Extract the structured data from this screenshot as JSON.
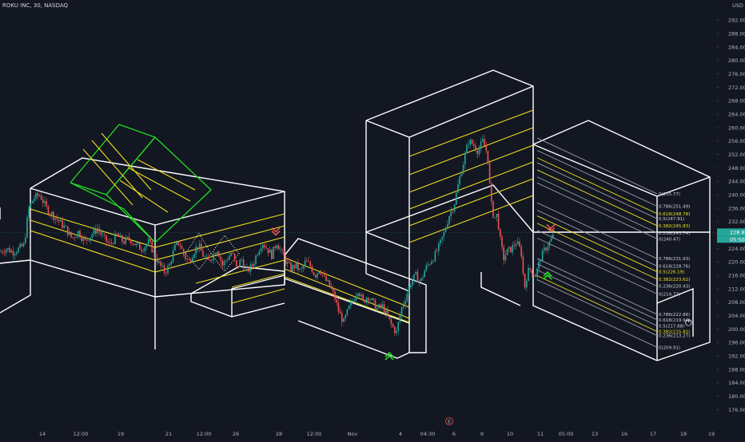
{
  "header": {
    "ticker": "ROKU INC, 30, NASDAQ",
    "currency": "USD"
  },
  "price_tags": [
    {
      "value": "228.81",
      "color": "#26a69a"
    },
    {
      "value": "05:50",
      "color": "#26a69a"
    }
  ],
  "colors": {
    "background": "#131722",
    "up": "#26a69a",
    "down": "#ef5350",
    "box_lines": "#ffffff",
    "green_box": "#22dd22",
    "yellow_lines": "#f0e020",
    "fib_lines": "#9a9aa8"
  },
  "chart_data": {
    "type": "candlestick",
    "title": "ROKU INC, 30, NASDAQ",
    "y_axis": {
      "unit": "USD",
      "range": [
        174,
        296
      ],
      "ticks": [
        "292.00",
        "288.00",
        "284.00",
        "280.00",
        "276.00",
        "272.00",
        "268.00",
        "264.00",
        "260.00",
        "256.00",
        "252.00",
        "248.00",
        "244.00",
        "240.00",
        "236.00",
        "232.00",
        "228.00",
        "224.00",
        "220.00",
        "216.00",
        "212.00",
        "208.00",
        "204.00",
        "200.00",
        "196.00",
        "192.00",
        "188.00",
        "184.00",
        "180.00",
        "176.00"
      ]
    },
    "x_axis": {
      "tick_labels": [
        "14",
        "12:00",
        "19",
        "21",
        "12:00",
        "26",
        "28",
        "12:00",
        "Nov",
        "4",
        "04:30",
        "6",
        "9",
        "10",
        "11",
        "05:00",
        "13",
        "16",
        "17",
        "18",
        "19"
      ]
    },
    "price_path": [
      [
        0,
        223
      ],
      [
        8,
        224
      ],
      [
        16,
        223
      ],
      [
        24,
        224
      ],
      [
        30,
        225
      ],
      [
        36,
        236
      ],
      [
        42,
        239
      ],
      [
        50,
        240
      ],
      [
        58,
        236
      ],
      [
        66,
        234
      ],
      [
        74,
        232
      ],
      [
        82,
        230
      ],
      [
        90,
        227
      ],
      [
        98,
        229
      ],
      [
        106,
        226
      ],
      [
        114,
        228
      ],
      [
        122,
        230
      ],
      [
        130,
        227
      ],
      [
        138,
        225
      ],
      [
        146,
        228
      ],
      [
        154,
        226
      ],
      [
        162,
        227
      ],
      [
        170,
        225
      ],
      [
        178,
        224
      ],
      [
        186,
        226
      ],
      [
        194,
        222
      ],
      [
        200,
        219
      ],
      [
        206,
        217
      ],
      [
        212,
        219
      ],
      [
        218,
        224
      ],
      [
        224,
        226
      ],
      [
        230,
        222
      ],
      [
        236,
        220
      ],
      [
        242,
        223
      ],
      [
        248,
        225
      ],
      [
        254,
        222
      ],
      [
        260,
        220
      ],
      [
        266,
        222
      ],
      [
        272,
        224
      ],
      [
        278,
        219
      ],
      [
        284,
        221
      ],
      [
        290,
        223
      ],
      [
        296,
        218
      ],
      [
        302,
        221
      ],
      [
        308,
        217
      ],
      [
        316,
        219
      ],
      [
        322,
        223
      ],
      [
        328,
        226
      ],
      [
        334,
        224
      ],
      [
        340,
        222
      ],
      [
        346,
        226
      ],
      [
        352,
        223
      ],
      [
        358,
        220
      ],
      [
        364,
        218
      ],
      [
        370,
        219
      ],
      [
        376,
        217
      ],
      [
        382,
        220
      ],
      [
        388,
        219
      ],
      [
        394,
        216
      ],
      [
        400,
        218
      ],
      [
        406,
        215
      ],
      [
        412,
        213
      ],
      [
        418,
        210
      ],
      [
        424,
        205
      ],
      [
        430,
        202
      ],
      [
        436,
        206
      ],
      [
        442,
        209
      ],
      [
        448,
        212
      ],
      [
        454,
        208
      ],
      [
        460,
        210
      ],
      [
        466,
        208
      ],
      [
        472,
        206
      ],
      [
        478,
        207
      ],
      [
        484,
        204
      ],
      [
        490,
        201
      ],
      [
        496,
        199
      ],
      [
        502,
        206
      ],
      [
        508,
        210
      ],
      [
        514,
        214
      ],
      [
        520,
        216
      ],
      [
        526,
        214
      ],
      [
        532,
        218
      ],
      [
        538,
        220
      ],
      [
        544,
        222
      ],
      [
        550,
        225
      ],
      [
        556,
        229
      ],
      [
        562,
        234
      ],
      [
        568,
        237
      ],
      [
        574,
        244
      ],
      [
        580,
        250
      ],
      [
        586,
        256
      ],
      [
        592,
        255
      ],
      [
        598,
        253
      ],
      [
        604,
        256
      ],
      [
        610,
        252
      ],
      [
        614,
        238
      ],
      [
        618,
        233
      ],
      [
        622,
        234
      ],
      [
        626,
        226
      ],
      [
        630,
        221
      ],
      [
        634,
        223
      ],
      [
        640,
        224
      ],
      [
        646,
        226
      ],
      [
        652,
        223
      ],
      [
        656,
        212
      ],
      [
        660,
        217
      ],
      [
        664,
        218
      ],
      [
        670,
        216
      ],
      [
        676,
        221
      ],
      [
        682,
        224
      ],
      [
        688,
        226
      ],
      [
        693,
        228
      ]
    ],
    "fib_levels": [
      {
        "label": "0(255.77)",
        "price": 240.3,
        "highlight": false
      },
      {
        "label": "0.786(251.49)",
        "price": 236.6,
        "highlight": false
      },
      {
        "label": "0.618(248.78)",
        "price": 234.4,
        "highlight": true
      },
      {
        "label": "0.5(247.91)",
        "price": 232.9,
        "highlight": false
      },
      {
        "label": "0.382(245.83)",
        "price": 230.8,
        "highlight": true
      },
      {
        "label": "0.236(243.74)",
        "price": 228.7,
        "highlight": false
      },
      {
        "label": "0(240.47)",
        "price": 226.9,
        "highlight": false
      },
      {
        "label": "0.786(231.93)",
        "price": 221.0,
        "highlight": false
      },
      {
        "label": "0.618(228.76)",
        "price": 218.8,
        "highlight": false
      },
      {
        "label": "0.5(226.19)",
        "price": 217.1,
        "highlight": true
      },
      {
        "label": "0.382(223.62)",
        "price": 214.9,
        "highlight": true
      },
      {
        "label": "0.236(220.43)",
        "price": 212.8,
        "highlight": false
      },
      {
        "label": "0(214.73)",
        "price": 210.5,
        "highlight": false
      },
      {
        "label": "0.786(222.86)",
        "price": 204.4,
        "highlight": false
      },
      {
        "label": "0.618(219.94)",
        "price": 202.8,
        "highlight": false
      },
      {
        "label": "0.5(217.88)",
        "price": 201.0,
        "highlight": false
      },
      {
        "label": "0.382(215.82)",
        "price": 199.3,
        "highlight": true
      },
      {
        "label": "0.236(213.27)",
        "price": 198.1,
        "highlight": false
      },
      {
        "label": "0(209.91)",
        "price": 194.6,
        "highlight": false
      }
    ],
    "signals": [
      {
        "kind": "sell",
        "time": 345,
        "price": 229
      },
      {
        "kind": "buy",
        "time": 487,
        "price": 193
      },
      {
        "kind": "sell",
        "time": 689,
        "price": 230
      },
      {
        "kind": "buy",
        "time": 685,
        "price": 217
      }
    ]
  },
  "icons": {
    "settings": "⏻",
    "earnings": "E"
  }
}
